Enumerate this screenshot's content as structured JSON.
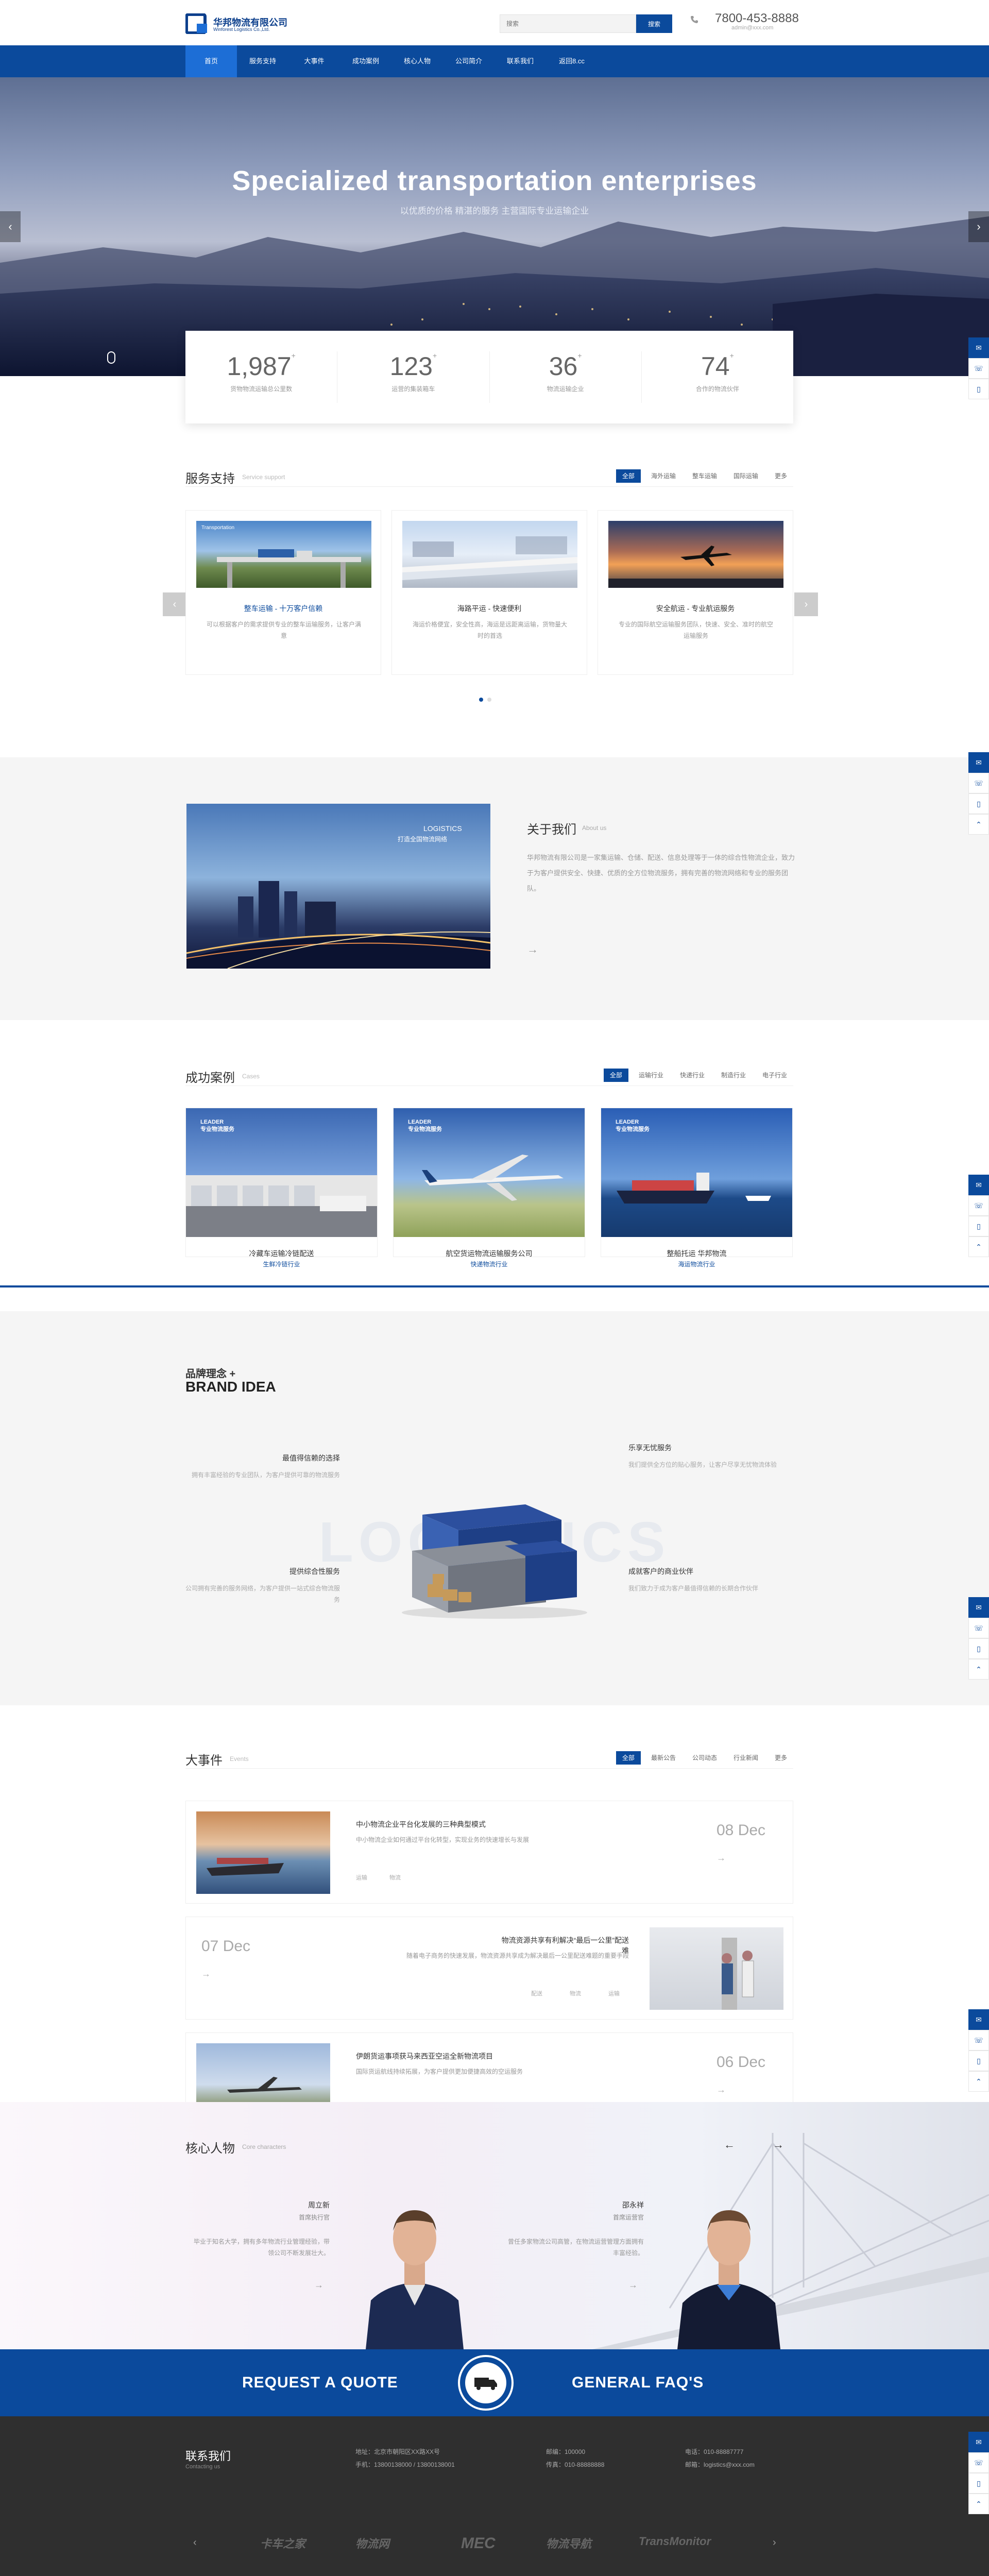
{
  "header": {
    "logo_cn": "华邦物流有限公司",
    "logo_en": "Winforest Logistics Co.,Ltd.",
    "search_placeholder": "搜索",
    "search_button": "搜索",
    "phone": "7800-453-8888",
    "email": "admin@xxx.com"
  },
  "nav": [
    "首页",
    "服务支持",
    "大事件",
    "成功案例",
    "核心人物",
    "公司简介",
    "联系我们",
    "返回8.cc"
  ],
  "hero": {
    "title": "Specialized transportation enterprises",
    "subtitle": "以优质的价格 精湛的服务 主营国际专业运输企业"
  },
  "stats": [
    {
      "num": "1,987",
      "sup": "+",
      "label": "货物物流运输总公里数"
    },
    {
      "num": "123",
      "sup": "+",
      "label": "运营的集装箱车"
    },
    {
      "num": "36",
      "sup": "+",
      "label": "物流运输企业"
    },
    {
      "num": "74",
      "sup": "+",
      "label": "合作的物流伙伴"
    }
  ],
  "service": {
    "title": "服务支持",
    "en": "Service support",
    "tabs": [
      "全部",
      "海外运输",
      "整车运输",
      "国际运输",
      "更多"
    ],
    "cards": [
      {
        "title": "整车运输 - 十万客户信赖",
        "desc": "可以根据客户的需求提供专业的整车运输服务，让客户满意",
        "tag": "Transportation"
      },
      {
        "title": "海路平运 - 快速便利",
        "desc": "海运价格便宜，安全性高，海运是远距离运输，货物量大时的首选",
        "tag": ""
      },
      {
        "title": "安全航运 - 专业航运服务",
        "desc": "专业的国际航空运输服务团队，快速、安全、准时的航空运输服务",
        "tag": ""
      }
    ]
  },
  "about": {
    "title": "关于我们",
    "en": "About us",
    "img_caption": "LOGISTICS",
    "img_caption_cn": "打造全国物流网络",
    "text": "华邦物流有限公司是一家集运输、仓储、配送、信息处理等于一体的综合性物流企业，致力于为客户提供安全、快捷、优质的全方位物流服务，拥有完善的物流网络和专业的服务团队。",
    "more": "→"
  },
  "cases": {
    "title": "成功案例",
    "en": "Cases",
    "tabs": [
      "全部",
      "运输行业",
      "快递行业",
      "制造行业",
      "电子行业"
    ],
    "items": [
      {
        "tag": "LEADER",
        "tag_cn": "专业物流服务",
        "title": "冷藏车运输冷链配送",
        "sub": "生鲜冷链行业"
      },
      {
        "tag": "LEADER",
        "tag_cn": "专业物流服务",
        "title": "航空货运物流运输服务公司",
        "sub": "快递物流行业"
      },
      {
        "tag": "LEADER",
        "tag_cn": "专业物流服务",
        "title": "整船托运 华邦物流",
        "sub": "海运物流行业"
      }
    ]
  },
  "brand": {
    "cn": "品牌理念 +",
    "en": "BRAND IDEA",
    "watermark": "LOGISTICS",
    "items": [
      {
        "title": "最值得信赖的选择",
        "desc": "拥有丰富经验的专业团队，为客户提供可靠的物流服务"
      },
      {
        "title": "乐享无忧服务",
        "desc": "我们提供全方位的贴心服务，让客户尽享无忧物流体验"
      },
      {
        "title": "提供综合性服务",
        "desc": "公司拥有完善的服务网络，为客户提供一站式综合物流服务"
      },
      {
        "title": "成就客户的商业伙伴",
        "desc": "我们致力于成为客户最值得信赖的长期合作伙伴"
      }
    ]
  },
  "events": {
    "title": "大事件",
    "en": "Events",
    "tabs": [
      "全部",
      "最新公告",
      "公司动态",
      "行业新闻",
      "更多"
    ],
    "items": [
      {
        "title": "中小物流企业平台化发展的三种典型模式",
        "desc": "中小物流企业如何通过平台化转型，实现业务的快速增长与发展",
        "meta1": "运输",
        "meta2": "物流",
        "date": "08 Dec"
      },
      {
        "title": "物流资源共享有利解决“最后一公里”配送难",
        "desc": "随着电子商务的快速发展，物流资源共享成为解决最后一公里配送难题的重要手段",
        "meta1": "配送",
        "meta2": "物流",
        "meta3": "运输",
        "date": "07 Dec"
      },
      {
        "title": "伊朗货运事项获马来西亚空运全新物流项目",
        "desc": "国际货运航线持续拓展，为客户提供更加便捷高效的空运服务",
        "meta1": "",
        "meta2": "",
        "date": "06 Dec"
      }
    ]
  },
  "people": {
    "title": "核心人物",
    "en": "Core characters",
    "persons": [
      {
        "name": "周立新",
        "role": "首席执行官",
        "desc": "毕业于知名大学，拥有多年物流行业管理经验，带领公司不断发展壮大。"
      },
      {
        "name": "邵永祥",
        "role": "首席运营官",
        "desc": "曾任多家物流公司高管，在物流运营管理方面拥有丰富经验。"
      }
    ]
  },
  "quote": {
    "left": "REQUEST A QUOTE",
    "right": "GENERAL FAQ'S"
  },
  "footer": {
    "title": "联系我们",
    "en": "Contacting us",
    "addr": "地址：北京市朝阳区XX路XX号",
    "phone_lbl": "手机：13800138000 / 13800138001",
    "post": "邮编：100000",
    "fax": "传真：010-88888888",
    "tel": "电话：010-88887777",
    "mail": "邮箱：logistics@xxx.com",
    "partners": [
      "卡车之家",
      "物流网",
      "MEC",
      "物流导航",
      "TransMonitor"
    ]
  }
}
